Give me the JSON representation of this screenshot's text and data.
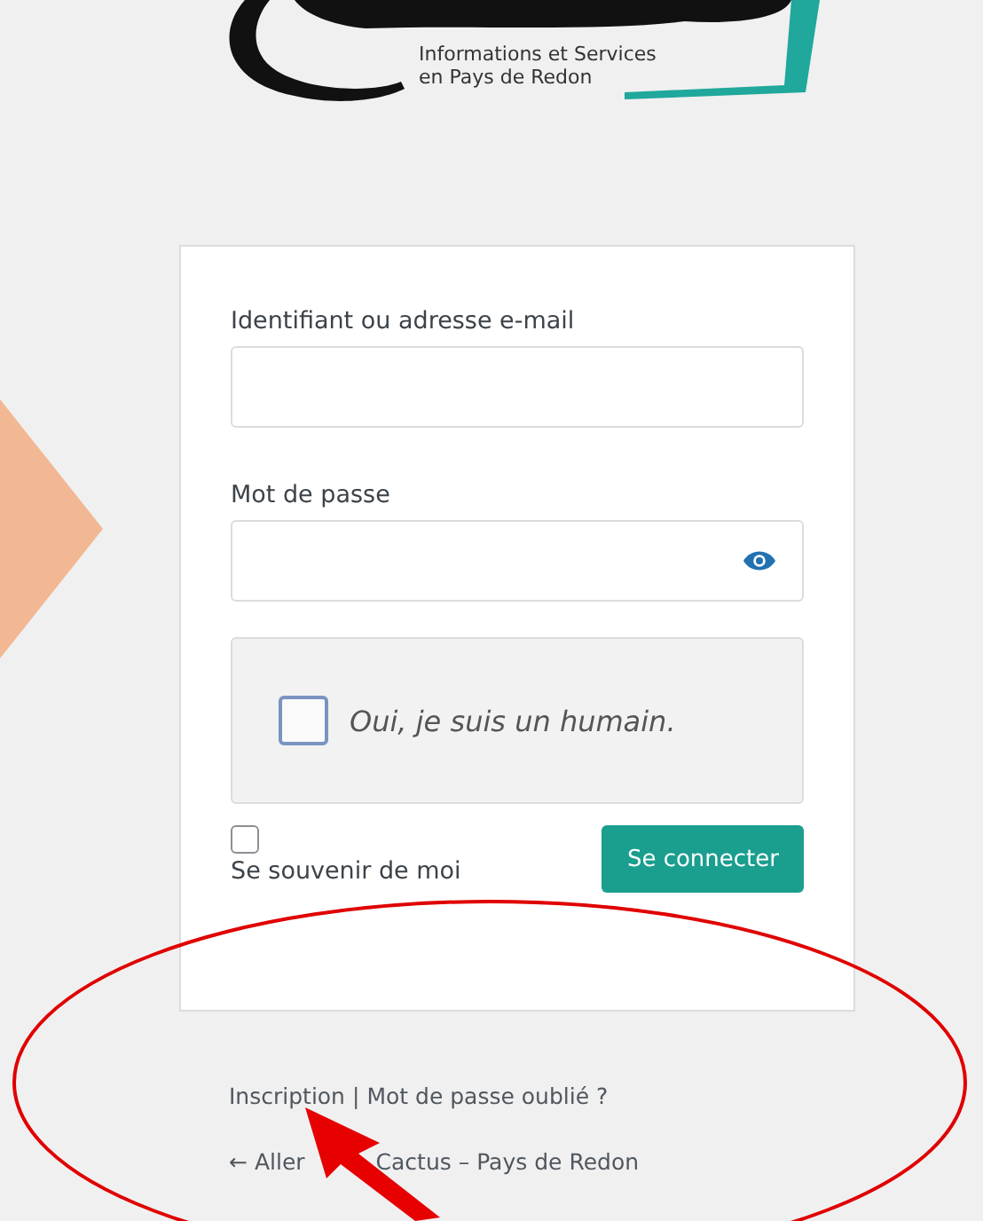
{
  "logo": {
    "tagline_lines": [
      "Informations et Services",
      "en Pays de Redon"
    ]
  },
  "login_form": {
    "username": {
      "label": "Identifiant ou adresse e-mail"
    },
    "password": {
      "label": "Mot de passe"
    },
    "captcha": {
      "label": "Oui, je suis un humain.",
      "checked": false
    },
    "remember_me": {
      "label": "Se souvenir de moi",
      "checked": false
    },
    "submit": "Se connecter"
  },
  "nav_links": [
    {
      "label": "Inscription"
    },
    {
      "label": "Mot de passe oublié ?"
    }
  ],
  "separator": "|",
  "back_link": {
    "parts": [
      "← Aller",
      "Cactus – Pays de Redon"
    ]
  }
}
